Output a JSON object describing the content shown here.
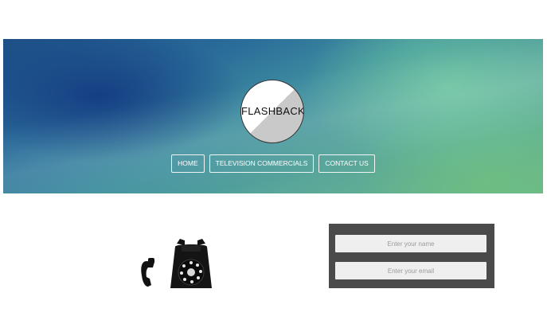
{
  "brand": {
    "logo_text": "FLASHBACK"
  },
  "nav": [
    {
      "label": "HOME"
    },
    {
      "label": "TELEVISION COMMERCIALS"
    },
    {
      "label": "CONTACT US"
    }
  ],
  "contact_form": {
    "name_placeholder": "Enter your name",
    "email_placeholder": "Enter your email"
  },
  "colors": {
    "form_background": "#4a4a4a",
    "field_background": "#efefef",
    "nav_text": "#ffffff"
  },
  "icons": {
    "hero_image": "rotary-telephone-icon"
  }
}
